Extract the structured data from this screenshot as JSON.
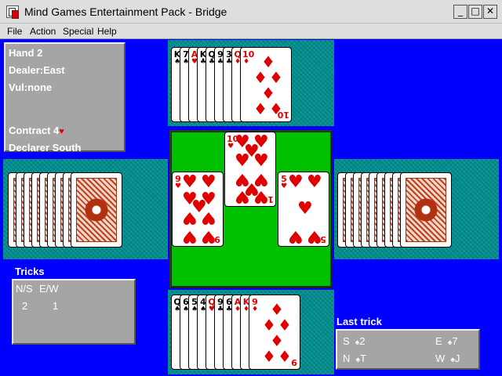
{
  "window": {
    "title": "Mind Games Entertainment Pack - Bridge",
    "minimize": "_",
    "maximize": "□",
    "close": "✕"
  },
  "menu": [
    "File",
    "Action",
    "Special",
    "Help"
  ],
  "info": {
    "hand": "Hand 2",
    "dealer": "Dealer:East",
    "vul": "Vul:none",
    "contract": "Contract 4",
    "contract_suit": "♥",
    "declarer": "Declarer South"
  },
  "tricks": {
    "label": "Tricks",
    "ns_label": "N/S",
    "ew_label": "E/W",
    "ns": "2",
    "ew": "1"
  },
  "last_trick": {
    "label": "Last trick",
    "entries": [
      {
        "seat": "S",
        "suit": "♠",
        "rank": "2"
      },
      {
        "seat": "E",
        "suit": "♠",
        "rank": "7"
      },
      {
        "seat": "N",
        "suit": "♠",
        "rank": "T"
      },
      {
        "seat": "W",
        "suit": "♠",
        "rank": "J"
      }
    ]
  },
  "north_hand": [
    {
      "rank": "K",
      "suit": "♠",
      "color": "black"
    },
    {
      "rank": "7",
      "suit": "♠",
      "color": "black"
    },
    {
      "rank": "A",
      "suit": "♥",
      "color": "red"
    },
    {
      "rank": "K",
      "suit": "♣",
      "color": "black"
    },
    {
      "rank": "Q",
      "suit": "♣",
      "color": "black"
    },
    {
      "rank": "9",
      "suit": "♣",
      "color": "black"
    },
    {
      "rank": "3",
      "suit": "♣",
      "color": "black"
    },
    {
      "rank": "Q",
      "suit": "♦",
      "color": "red"
    },
    {
      "rank": "10",
      "suit": "♦",
      "color": "red"
    }
  ],
  "south_hand": [
    {
      "rank": "Q",
      "suit": "♠",
      "color": "black"
    },
    {
      "rank": "6",
      "suit": "♠",
      "color": "black"
    },
    {
      "rank": "5",
      "suit": "♠",
      "color": "black"
    },
    {
      "rank": "4",
      "suit": "♠",
      "color": "black"
    },
    {
      "rank": "Q",
      "suit": "♥",
      "color": "red"
    },
    {
      "rank": "9",
      "suit": "♣",
      "color": "black"
    },
    {
      "rank": "6",
      "suit": "♣",
      "color": "black"
    },
    {
      "rank": "A",
      "suit": "♦",
      "color": "red"
    },
    {
      "rank": "K",
      "suit": "♦",
      "color": "red"
    },
    {
      "rank": "9",
      "suit": "♦",
      "color": "red"
    }
  ],
  "trick_cards": {
    "north": {
      "rank": "10",
      "suit": "♥"
    },
    "west": {
      "rank": "9",
      "suit": "♥"
    },
    "east": {
      "rank": "5",
      "suit": "♥"
    }
  },
  "colors": {
    "table": "#00C000",
    "felt": "#0000FF",
    "panel": "#A5A5A5",
    "red": "#E00000"
  }
}
